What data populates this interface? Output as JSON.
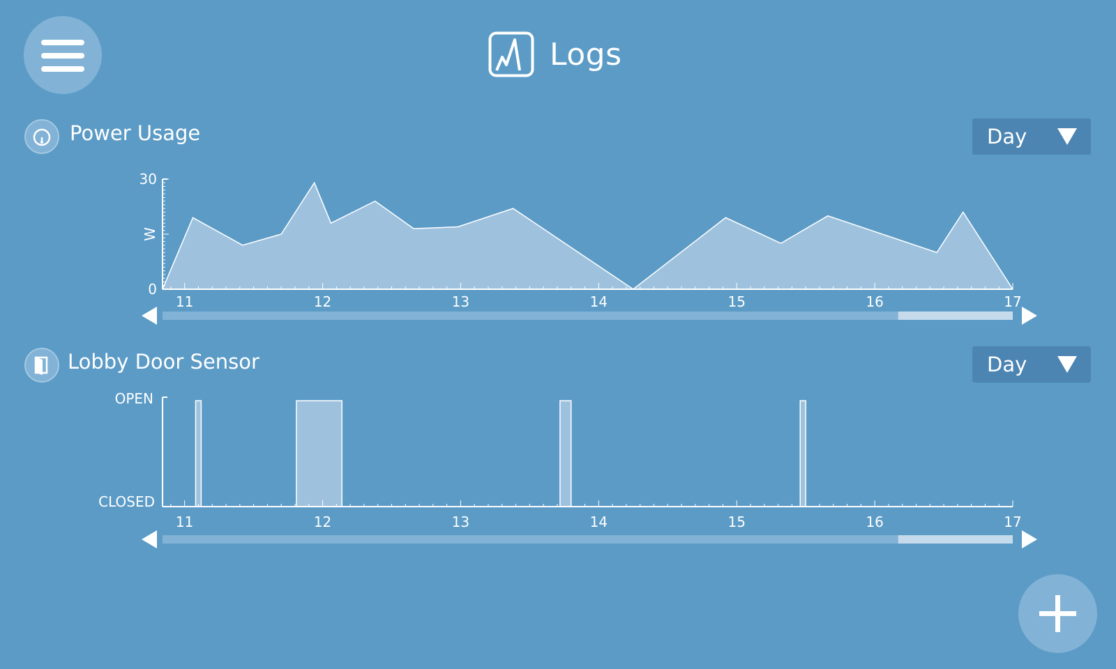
{
  "header": {
    "title": "Logs",
    "icon": "logs-chart-icon"
  },
  "menu": {
    "icon": "hamburger-menu-icon"
  },
  "fab": {
    "icon": "plus-icon"
  },
  "colors": {
    "background": "#5b9bc6",
    "button_circle": "#82b3d6",
    "dropdown": "#4c84b2",
    "chart_fill": "#9ec2de",
    "scroll_track": "#82b3d6",
    "scroll_thumb": "#c5dbec",
    "foreground": "#ffffff"
  },
  "power": {
    "title": "Power Usage",
    "icon": "gauge-icon",
    "range_select": {
      "value": "Day",
      "icon": "triangle-down-icon"
    },
    "scroll": {
      "window_start": 16.17,
      "window_end": 17,
      "left_icon": "arrow-left-icon",
      "right_icon": "arrow-right-icon"
    }
  },
  "door": {
    "title": "Lobby Door Sensor",
    "icon": "door-icon",
    "range_select": {
      "value": "Day",
      "icon": "triangle-down-icon"
    },
    "scroll": {
      "window_start": 16.17,
      "window_end": 17,
      "left_icon": "arrow-left-icon",
      "right_icon": "arrow-right-icon"
    }
  },
  "chart_data": [
    {
      "type": "area",
      "title": "Power Usage",
      "xlabel": "",
      "ylabel": "W",
      "xlim": [
        10.84,
        17
      ],
      "ylim": [
        0,
        30
      ],
      "x_ticks": [
        "11",
        "12",
        "13",
        "14",
        "15",
        "16",
        "17"
      ],
      "y_ticks": [
        "0",
        "30"
      ],
      "grid": false,
      "series": [
        {
          "x": [
            10.84,
            11.06,
            11.42,
            11.7,
            11.94,
            12.06,
            12.38,
            12.66,
            12.98,
            13.38,
            14.25,
            14.92,
            15.32,
            15.66,
            16.45,
            16.64,
            17.0
          ],
          "values": [
            0,
            19.5,
            12,
            15,
            29,
            18,
            24,
            16.5,
            17,
            22,
            0,
            19.5,
            12.5,
            20,
            10,
            21,
            0
          ]
        }
      ]
    },
    {
      "type": "bar",
      "title": "Lobby Door Sensor",
      "xlabel": "",
      "ylabel": "",
      "xlim": [
        10.84,
        17
      ],
      "y_categories": [
        "CLOSED",
        "OPEN"
      ],
      "x_ticks": [
        "11",
        "12",
        "13",
        "14",
        "15",
        "16",
        "17"
      ],
      "grid": false,
      "series": [
        {
          "name": "",
          "open_intervals": [
            [
              11.08,
              11.12
            ],
            [
              11.81,
              12.14
            ],
            [
              13.72,
              13.8
            ],
            [
              15.46,
              15.5
            ]
          ]
        }
      ]
    }
  ]
}
